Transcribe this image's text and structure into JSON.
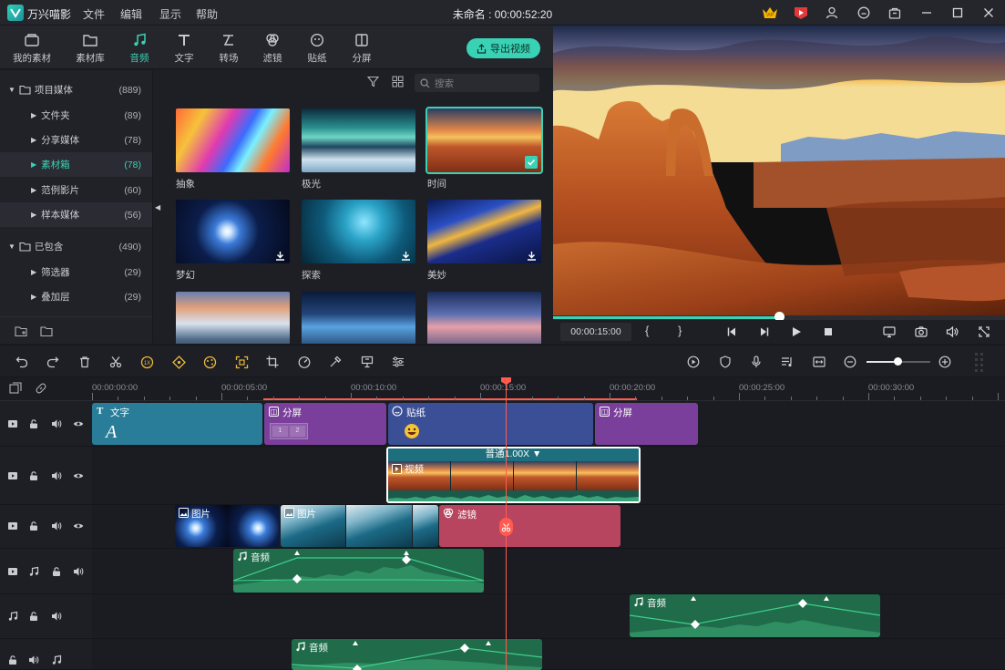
{
  "titlebar": {
    "app_name": "万兴喵影",
    "menus": [
      "文件",
      "编辑",
      "显示",
      "帮助"
    ],
    "project_title": "未命名 : 00:00:52:20",
    "vip_badge": "VIP"
  },
  "library_tabs": [
    {
      "label": "我的素材",
      "icon": "folder-box-icon"
    },
    {
      "label": "素材库",
      "icon": "folder-icon"
    },
    {
      "label": "音频",
      "icon": "music-note-icon",
      "active": true
    },
    {
      "label": "文字",
      "icon": "text-T-icon"
    },
    {
      "label": "转场",
      "icon": "transition-icon"
    },
    {
      "label": "滤镜",
      "icon": "filter-circles-icon"
    },
    {
      "label": "贴纸",
      "icon": "sticker-face-icon"
    },
    {
      "label": "分屏",
      "icon": "split-screen-icon"
    }
  ],
  "export_button": "导出视频",
  "folder_tree": [
    {
      "label": "项目媒体",
      "count": "(889)",
      "level": 0
    },
    {
      "label": "文件夹",
      "count": "(89)",
      "level": 1
    },
    {
      "label": "分享媒体",
      "count": "(78)",
      "level": 1
    },
    {
      "label": "素材箱",
      "count": "(78)",
      "level": 1,
      "selected": true
    },
    {
      "label": "范例影片",
      "count": "(60)",
      "level": 1
    },
    {
      "label": "样本媒体",
      "count": "(56)",
      "level": 1
    },
    {
      "label": "已包含",
      "count": "(490)",
      "level": 0
    },
    {
      "label": "筛选器",
      "count": "(29)",
      "level": 1
    },
    {
      "label": "叠加层",
      "count": "(29)",
      "level": 1
    }
  ],
  "search": {
    "placeholder": "搜索"
  },
  "media_items": [
    {
      "label": "抽象"
    },
    {
      "label": "极光"
    },
    {
      "label": "时间",
      "selected": true
    },
    {
      "label": "梦幻"
    },
    {
      "label": "探索"
    },
    {
      "label": "美妙"
    },
    {
      "label": ""
    },
    {
      "label": ""
    },
    {
      "label": ""
    }
  ],
  "preview": {
    "timecode": "00:00:15:00",
    "mark_in": "{",
    "mark_out": "}",
    "progress": 0.5
  },
  "ruler": {
    "labels": [
      "00:00:00:00",
      "00:00:05:00",
      "00:00:10:00",
      "00:00:15:00",
      "00:00:20:00",
      "00:00:25:00",
      "00:00:30:00"
    ]
  },
  "clips": {
    "text": {
      "label": "文字",
      "glyph": "A"
    },
    "split1": {
      "label": "分屏",
      "n1": "1",
      "n2": "2"
    },
    "sticker": {
      "label": "贴纸"
    },
    "split2": {
      "label": "分屏"
    },
    "video": {
      "label": "视频",
      "speed": "普通1.00X ▼"
    },
    "image1": {
      "label": "图片"
    },
    "image2": {
      "label": "图片"
    },
    "filter": {
      "label": "滤镜"
    },
    "audio1": {
      "label": "音频"
    },
    "audio2": {
      "label": "音频"
    },
    "audio3": {
      "label": "音频"
    }
  },
  "colors": {
    "accent": "#3ad2b4",
    "text_clip": "#2a7d98",
    "split_clip": "#7a3f9a",
    "sticker_clip": "#3b4f96",
    "filter_clip": "#b84560",
    "audio_clip": "#1f6b4a",
    "playhead": "#ff5b4f"
  }
}
